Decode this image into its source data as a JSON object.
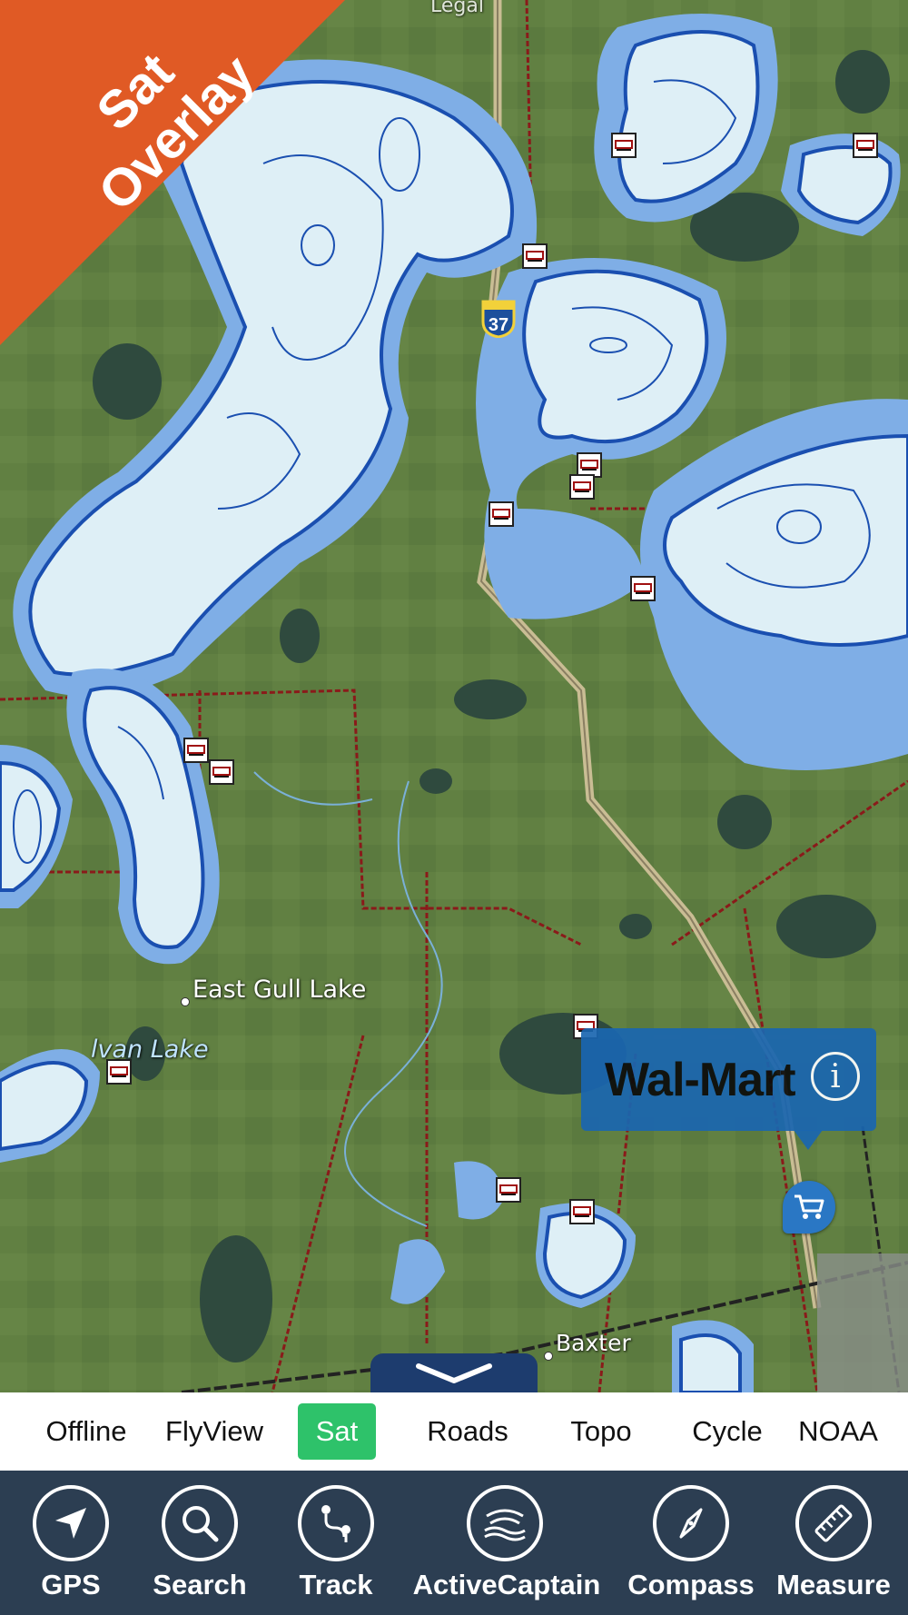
{
  "banner": {
    "line1": "Sat",
    "line2": "Overlay",
    "color": "#e05a25"
  },
  "map": {
    "top_partial_label": "Legal",
    "highway_shield": "37",
    "labels": {
      "town": "East Gull Lake",
      "lake": "lvan Lake",
      "city": "Baxter"
    }
  },
  "callout": {
    "title": "Wal-Mart",
    "info_icon": "info-icon"
  },
  "layers": {
    "tabs": [
      "Offline",
      "FlyView",
      "Sat",
      "Roads",
      "Topo",
      "Cycle",
      "NOAA"
    ],
    "active": "Sat",
    "active_color": "#2ec26a"
  },
  "toolbar": {
    "items": [
      {
        "label": "GPS",
        "icon": "gps-arrow-icon"
      },
      {
        "label": "Search",
        "icon": "search-icon"
      },
      {
        "label": "Track",
        "icon": "track-icon"
      },
      {
        "label": "ActiveCaptain",
        "icon": "activecaptain-icon"
      },
      {
        "label": "Compass",
        "icon": "compass-icon"
      },
      {
        "label": "Measure",
        "icon": "ruler-icon"
      }
    ],
    "background": "#2c3e52"
  }
}
